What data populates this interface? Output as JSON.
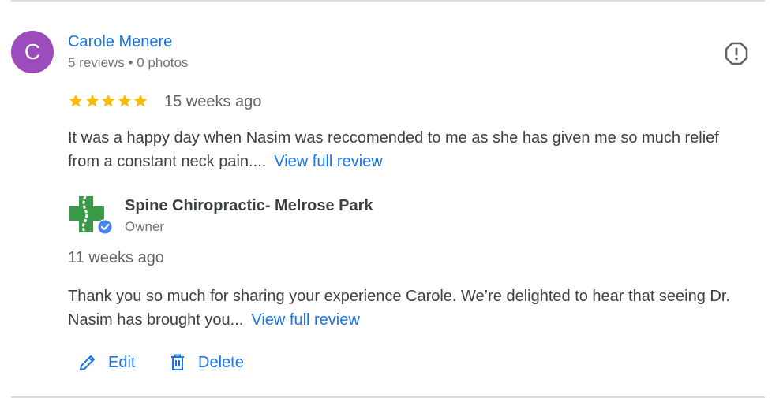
{
  "review": {
    "avatar_letter": "C",
    "avatar_color": "#9c4cbc",
    "reviewer_name": "Carole Menere",
    "reviewer_meta": "5 reviews • 0 photos",
    "rating": 5,
    "max_rating": 5,
    "date": "15 weeks ago",
    "text": "It was a happy day when Nasim was reccomended to me as she has given me so much relief from a constant neck pain....",
    "view_full_label": "View full review",
    "report_icon": "report-icon"
  },
  "reply": {
    "business_name": "Spine Chiropractic- Melrose Park",
    "role": "Owner",
    "date": "11 weeks ago",
    "text": "Thank you so much for sharing your experience Carole. We’re delighted to hear that seeing Dr. Nasim has brought you...",
    "view_full_label": "View full review",
    "verified": true
  },
  "actions": {
    "edit_label": "Edit",
    "delete_label": "Delete"
  },
  "colors": {
    "link": "#1a73e8",
    "star": "#fbbc04",
    "text": "#3c4043",
    "muted": "#70757a",
    "logo_green": "#3a9a47"
  }
}
